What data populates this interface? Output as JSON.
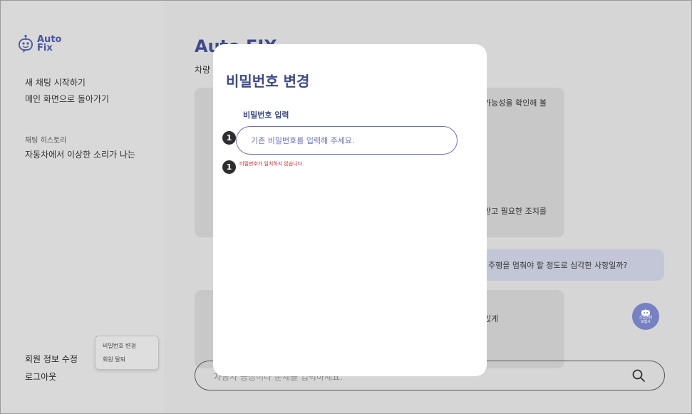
{
  "sidebar": {
    "logo_line1": "Auto",
    "logo_line2": "Fix",
    "new_chat": "새 채팅 시작하기",
    "back_main": "메인 화면으로 돌아가기",
    "history_caption": "채팅 히스토리",
    "history_item": "자동차에서 이상한 소리가 나는",
    "edit_profile": "회원 정보 수정",
    "logout": "로그아웃",
    "popover": {
      "change_password": "비밀번호 변경",
      "withdraw": "회원 탈퇴"
    }
  },
  "main": {
    "title": "Auto FIX",
    "subtitle": "차량",
    "bubble1_peek_top": "가능성을 확인해 볼",
    "bubble1_peek_bottom": "받고 필요한 조치를",
    "bubble2_text": "주행을 멈춰야 할 정도로 심각한 사항일까?",
    "bubble3_peek": "있게",
    "help_badge_line1": "긴급연락",
    "help_badge_line2": "보험사",
    "chat_placeholder": "자동차 증상이나 문제를 입력하세요."
  },
  "modal": {
    "title": "비밀번호 변경",
    "field_label": "비밀번호 입력",
    "input_placeholder": "기존 비밀번호를 입력해 주세요.",
    "error": "비밀번호가 일치하지 않습니다."
  },
  "markers": {
    "m1": "1",
    "m2": "1"
  },
  "colors": {
    "accent": "#3f4a8a",
    "error": "#e3242b",
    "badge": "#7680c2"
  }
}
